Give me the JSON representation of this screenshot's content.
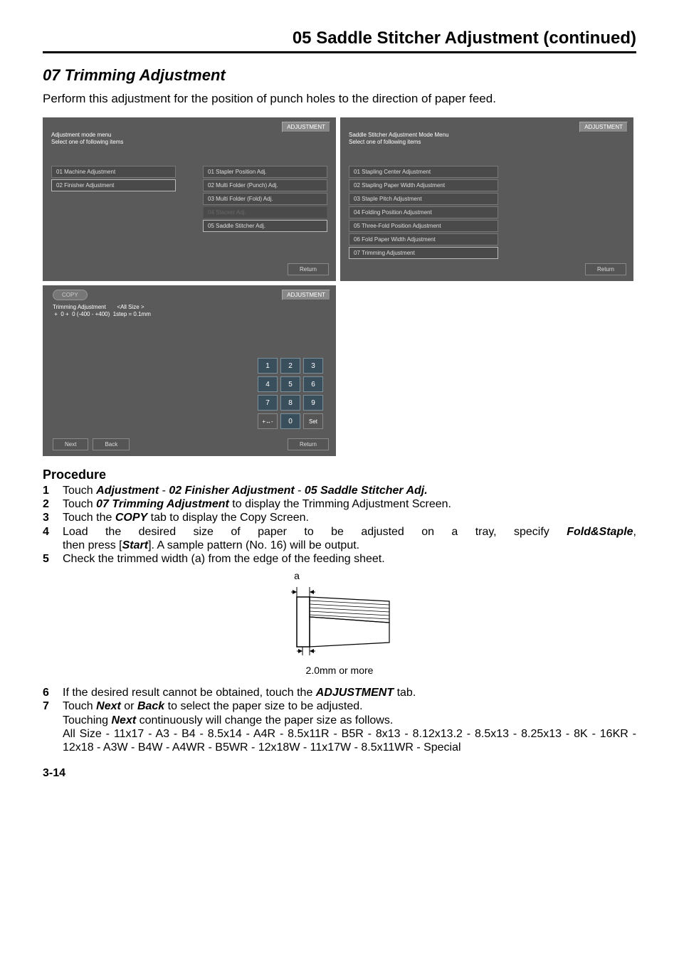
{
  "header": {
    "title": "05 Saddle Stitcher Adjustment (continued)"
  },
  "section_title": "07 Trimming Adjustment",
  "intro": "Perform this adjustment for the position of punch holes to the direction of paper feed.",
  "panel1": {
    "top_label": "ADJUSTMENT",
    "header_line1": "Adjustment mode menu",
    "header_line2": "Select one of following items",
    "left": [
      "01 Machine Adjustment",
      "02 Finisher Adjustment"
    ],
    "right": [
      "01 Stapler Position Adj.",
      "02 Multi Folder (Punch) Adj.",
      "03 Multi Folder (Fold) Adj.",
      "04 Stacker Adj.",
      "05 Saddle Stitcher Adj."
    ],
    "return": "Return"
  },
  "panel2": {
    "top_label": "ADJUSTMENT",
    "header_line1": "Saddle Stitcher Adjustment Mode Menu",
    "header_line2": "Select one of following items",
    "items": [
      "01 Stapling Center Adjustment",
      "02 Stapling Paper Width Adjustment",
      "03 Staple Pitch Adjustment",
      "04 Folding Position Adjustment",
      "05 Three-Fold Position Adjustment",
      "06 Fold Paper Width Adjustment",
      "07 Trimming Adjustment"
    ],
    "return": "Return"
  },
  "panel3": {
    "copy": "COPY",
    "top_label": "ADJUSTMENT",
    "trim_line1": "Trimming Adjustment       <All Size >",
    "trim_line2": " +  0 +  0 (-400 - +400)  1step = 0.1mm",
    "keys": [
      "1",
      "2",
      "3",
      "4",
      "5",
      "6",
      "7",
      "8",
      "9",
      "+↔-",
      "0",
      "Set"
    ],
    "next": "Next",
    "back": "Back",
    "return": "Return"
  },
  "procedure": {
    "heading": "Procedure",
    "steps": {
      "s1_a": "Touch ",
      "s1_b": "Adjustment",
      "s1_c": " - ",
      "s1_d": "02 Finisher Adjustment",
      "s1_e": " - ",
      "s1_f": "05 Saddle Stitcher Adj.",
      "s2_a": "Touch ",
      "s2_b": "07 Trimming Adjustment",
      "s2_c": " to display the Trimming Adjustment Screen.",
      "s3_a": "Touch the ",
      "s3_b": "COPY",
      "s3_c": " tab to display the Copy Screen.",
      "s4_line1_a": "Load the desired size of paper to be adjusted on a tray, specify ",
      "s4_line1_b": "Fold&Staple",
      "s4_line1_c": ",",
      "s4_line2_a": "then press [",
      "s4_line2_b": "Start",
      "s4_line2_c": "]. A sample pattern (No. 16) will be output.",
      "s5": "Check the trimmed width (a) from the edge of the feeding sheet.",
      "s6_a": "If the desired result cannot be obtained, touch the ",
      "s6_b": "ADJUSTMENT",
      "s6_c": " tab.",
      "s7_a": "Touch ",
      "s7_b": "Next",
      "s7_c": " or ",
      "s7_d": "Back",
      "s7_e": " to select the paper size to be adjusted.",
      "s7_line2_a": "Touching ",
      "s7_line2_b": "Next",
      "s7_line2_c": " continuously will change the paper size as follows.",
      "s7_line3": "All Size - 11x17 - A3 - B4 - 8.5x14 - A4R - 8.5x11R - B5R - 8x13 - 8.12x13.2 - 8.5x13 - 8.25x13 - 8K - 16KR - 12x18 - A3W - B4W - A4WR - B5WR - 12x18W - 11x17W - 8.5x11WR - Special"
    }
  },
  "diagram": {
    "label_a": "a",
    "caption": "2.0mm or more"
  },
  "page_number": "3-14"
}
